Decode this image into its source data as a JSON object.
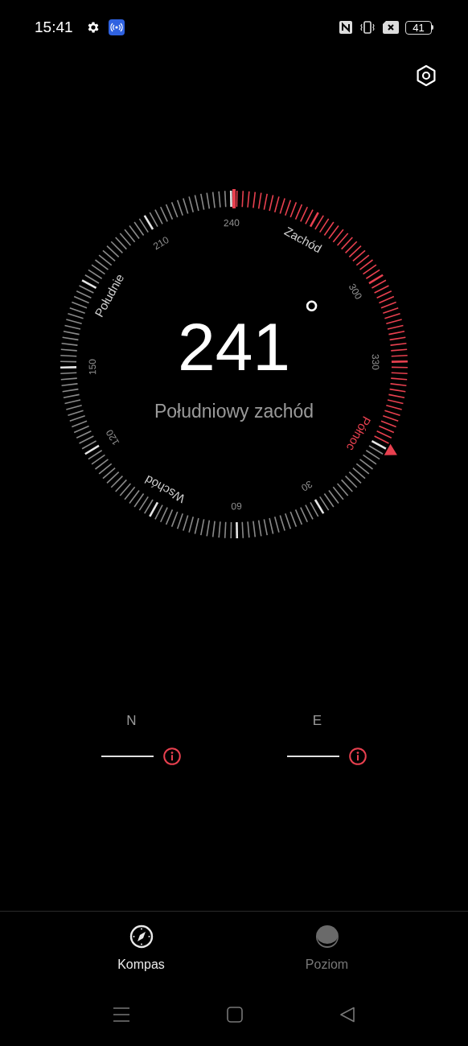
{
  "status_bar": {
    "time": "15:41",
    "battery": "41"
  },
  "dial": {
    "heading": "241",
    "unit": "°",
    "direction": "Południowy zachód",
    "labels": [
      {
        "text": "Północ",
        "kind": "north"
      },
      {
        "text": "30",
        "kind": "number"
      },
      {
        "text": "60",
        "kind": "number"
      },
      {
        "text": "Wschód",
        "kind": "cardinal"
      },
      {
        "text": "120",
        "kind": "number"
      },
      {
        "text": "150",
        "kind": "number"
      },
      {
        "text": "Południe",
        "kind": "cardinal"
      },
      {
        "text": "210",
        "kind": "number"
      },
      {
        "text": "240",
        "kind": "number"
      },
      {
        "text": "Zachód",
        "kind": "cardinal"
      },
      {
        "text": "300",
        "kind": "number"
      },
      {
        "text": "330",
        "kind": "number"
      }
    ]
  },
  "coordinates": [
    {
      "label": "N"
    },
    {
      "label": "E"
    }
  ],
  "tabs": [
    {
      "label": "Kompas",
      "kind": "compass",
      "selected": true
    },
    {
      "label": "Poziom",
      "kind": "level",
      "selected": false
    }
  ]
}
